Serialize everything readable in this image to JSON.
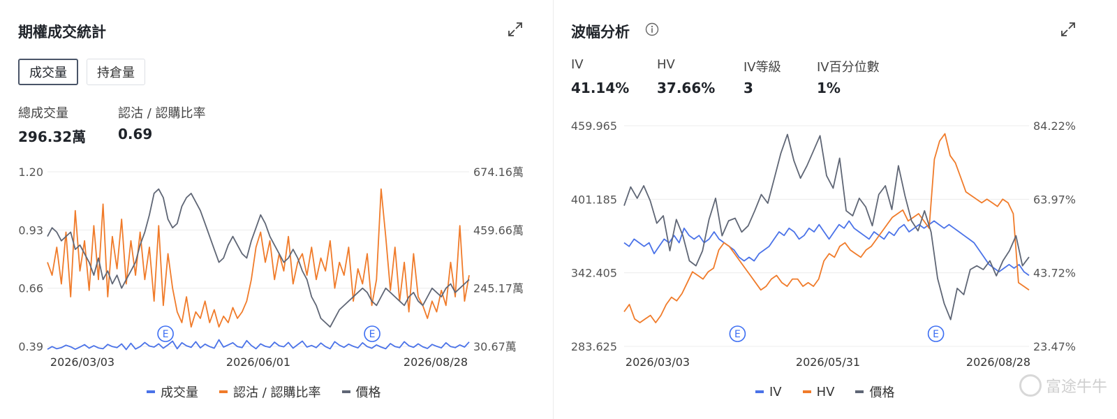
{
  "left_panel": {
    "title": "期權成交統計",
    "toggles": [
      "成交量",
      "持倉量"
    ],
    "stats": [
      {
        "label": "總成交量",
        "value": "296.32萬"
      },
      {
        "label": "認沽 / 認購比率",
        "value": "0.69"
      }
    ],
    "legend": [
      {
        "label": "成交量",
        "color": "#4a72e8"
      },
      {
        "label": "認沽 / 認購比率",
        "color": "#f07b2a"
      },
      {
        "label": "價格",
        "color": "#5f6675"
      }
    ]
  },
  "right_panel": {
    "title": "波幅分析",
    "stats": [
      {
        "label": "IV",
        "value": "41.14%"
      },
      {
        "label": "HV",
        "value": "37.66%"
      },
      {
        "label": "IV等級",
        "value": "3"
      },
      {
        "label": "IV百分位數",
        "value": "1%"
      }
    ],
    "legend": [
      {
        "label": "IV",
        "color": "#4a72e8"
      },
      {
        "label": "HV",
        "color": "#f07b2a"
      },
      {
        "label": "價格",
        "color": "#5f6675"
      }
    ]
  },
  "watermark": "富途牛牛",
  "colors": {
    "blue": "#4a72e8",
    "orange": "#f07b2a",
    "gray": "#5f6675",
    "grid": "#ececec"
  },
  "chart_data": [
    {
      "type": "line",
      "title": "期權成交統計",
      "x_ticks": [
        "2026/03/03",
        "2026/06/01",
        "2026/08/28"
      ],
      "y_left_ticks": [
        "1.20",
        "0.93",
        "0.66",
        "0.39"
      ],
      "y_right_ticks": [
        "674.16萬",
        "459.66萬",
        "245.17萬",
        "30.67萬"
      ],
      "event_markers": [
        "E",
        "E"
      ],
      "event_positions": [
        0.28,
        0.77
      ],
      "series": [
        {
          "name": "成交量",
          "axis": "right",
          "values": [
            20,
            30,
            22,
            26,
            35,
            29,
            20,
            28,
            37,
            24,
            33,
            25,
            22,
            38,
            30,
            26,
            40,
            19,
            42,
            21,
            30,
            45,
            32,
            28,
            40,
            24,
            36,
            50,
            22,
            44,
            33,
            27,
            48,
            25,
            39,
            30,
            24,
            55,
            28,
            36,
            44,
            30,
            26,
            52,
            34,
            22,
            40,
            31,
            27,
            46,
            33,
            29,
            45,
            24,
            37,
            50,
            28,
            34,
            26,
            43,
            30,
            22,
            48,
            35,
            27,
            39,
            31,
            25,
            44,
            30,
            24,
            36,
            28,
            22,
            41,
            30,
            26,
            48,
            33,
            27,
            40,
            29,
            23,
            38,
            31,
            25,
            44,
            30,
            26,
            36,
            28,
            47
          ]
        },
        {
          "name": "認沽 / 認購比率",
          "axis": "left",
          "values": [
            0.78,
            0.72,
            0.85,
            0.68,
            0.92,
            0.62,
            1.02,
            0.74,
            0.88,
            0.65,
            0.95,
            0.7,
            1.05,
            0.62,
            0.9,
            0.75,
            0.98,
            0.68,
            0.88,
            0.72,
            0.92,
            0.7,
            0.85,
            0.6,
            0.95,
            0.58,
            0.82,
            0.66,
            0.55,
            0.5,
            0.62,
            0.48,
            0.55,
            0.52,
            0.6,
            0.5,
            0.56,
            0.48,
            0.53,
            0.5,
            0.57,
            0.52,
            0.55,
            0.6,
            0.7,
            0.85,
            0.92,
            0.78,
            0.88,
            0.7,
            0.82,
            0.74,
            0.9,
            0.68,
            0.78,
            0.82,
            0.72,
            0.85,
            0.7,
            0.8,
            0.74,
            0.88,
            0.66,
            0.78,
            0.72,
            0.85,
            0.6,
            0.75,
            0.68,
            0.82,
            0.58,
            0.7,
            1.12,
            0.9,
            0.65,
            0.85,
            0.6,
            0.78,
            0.55,
            0.82,
            0.62,
            0.58,
            0.52,
            0.6,
            0.55,
            0.65,
            0.58,
            0.78,
            0.62,
            0.95,
            0.6,
            0.72
          ]
        },
        {
          "name": "價格",
          "axis": "left",
          "values": [
            0.9,
            0.94,
            0.92,
            0.88,
            0.9,
            0.92,
            0.84,
            0.86,
            0.82,
            0.78,
            0.72,
            0.8,
            0.7,
            0.74,
            0.68,
            0.72,
            0.66,
            0.7,
            0.74,
            0.78,
            0.86,
            0.92,
            1.0,
            1.1,
            1.12,
            1.08,
            0.98,
            0.94,
            0.96,
            1.04,
            1.08,
            1.1,
            1.06,
            1.02,
            0.96,
            0.9,
            0.84,
            0.78,
            0.8,
            0.86,
            0.9,
            0.86,
            0.82,
            0.8,
            0.88,
            0.94,
            1.0,
            0.96,
            0.9,
            0.86,
            0.82,
            0.78,
            0.8,
            0.84,
            0.8,
            0.74,
            0.7,
            0.62,
            0.58,
            0.52,
            0.5,
            0.48,
            0.52,
            0.56,
            0.58,
            0.6,
            0.62,
            0.64,
            0.66,
            0.64,
            0.6,
            0.58,
            0.62,
            0.66,
            0.64,
            0.62,
            0.6,
            0.58,
            0.62,
            0.64,
            0.6,
            0.58,
            0.62,
            0.66,
            0.64,
            0.62,
            0.66,
            0.68,
            0.64,
            0.66,
            0.68,
            0.7
          ]
        }
      ]
    },
    {
      "type": "line",
      "title": "波幅分析",
      "x_ticks": [
        "2026/03/03",
        "2026/05/31",
        "2026/08/28"
      ],
      "y_left_ticks": [
        "459.965",
        "401.185",
        "342.405",
        "283.625"
      ],
      "y_right_ticks": [
        "84.22%",
        "63.97%",
        "43.72%",
        "23.47%"
      ],
      "event_markers": [
        "E",
        "E"
      ],
      "event_positions": [
        0.28,
        0.77
      ],
      "series": [
        {
          "name": "IV",
          "axis": "right",
          "values": [
            52,
            51,
            53,
            52,
            51,
            52,
            49,
            51,
            53,
            52,
            54,
            52,
            56,
            54,
            53,
            54,
            52,
            53,
            55,
            53,
            52,
            51,
            50,
            48,
            47,
            48,
            47,
            49,
            50,
            51,
            53,
            55,
            54,
            56,
            55,
            53,
            54,
            56,
            55,
            57,
            55,
            53,
            55,
            57,
            56,
            58,
            56,
            55,
            54,
            53,
            55,
            54,
            53,
            55,
            54,
            56,
            57,
            55,
            56,
            57,
            56,
            57,
            58,
            57,
            56,
            57,
            56,
            55,
            54,
            53,
            52,
            50,
            48,
            46,
            45,
            44,
            45,
            46,
            45,
            46,
            44,
            43
          ]
        },
        {
          "name": "HV",
          "axis": "right",
          "values": [
            33,
            35,
            31,
            30,
            31,
            32,
            30,
            32,
            35,
            37,
            36,
            38,
            41,
            44,
            43,
            42,
            44,
            45,
            50,
            52,
            51,
            49,
            47,
            45,
            43,
            41,
            39,
            40,
            42,
            43,
            41,
            40,
            42,
            42,
            40,
            41,
            40,
            42,
            47,
            49,
            48,
            51,
            52,
            50,
            49,
            48,
            50,
            51,
            53,
            55,
            57,
            59,
            60,
            61,
            58,
            59,
            60,
            58,
            56,
            75,
            80,
            82,
            76,
            74,
            70,
            66,
            65,
            64,
            63,
            64,
            63,
            62,
            64,
            63,
            60,
            41,
            40,
            39
          ]
        },
        {
          "name": "價格",
          "axis": "left",
          "values": [
            396,
            411,
            402,
            412,
            400,
            382,
            388,
            360,
            385,
            372,
            352,
            348,
            360,
            385,
            402,
            372,
            384,
            386,
            375,
            380,
            392,
            405,
            398,
            418,
            438,
            453,
            432,
            418,
            428,
            440,
            452,
            420,
            410,
            434,
            392,
            388,
            402,
            395,
            380,
            405,
            412,
            393,
            428,
            404,
            384,
            376,
            392,
            375,
            338,
            318,
            305,
            330,
            325,
            345,
            348,
            345,
            352,
            340,
            352,
            360,
            372,
            348,
            355
          ]
        }
      ]
    }
  ]
}
